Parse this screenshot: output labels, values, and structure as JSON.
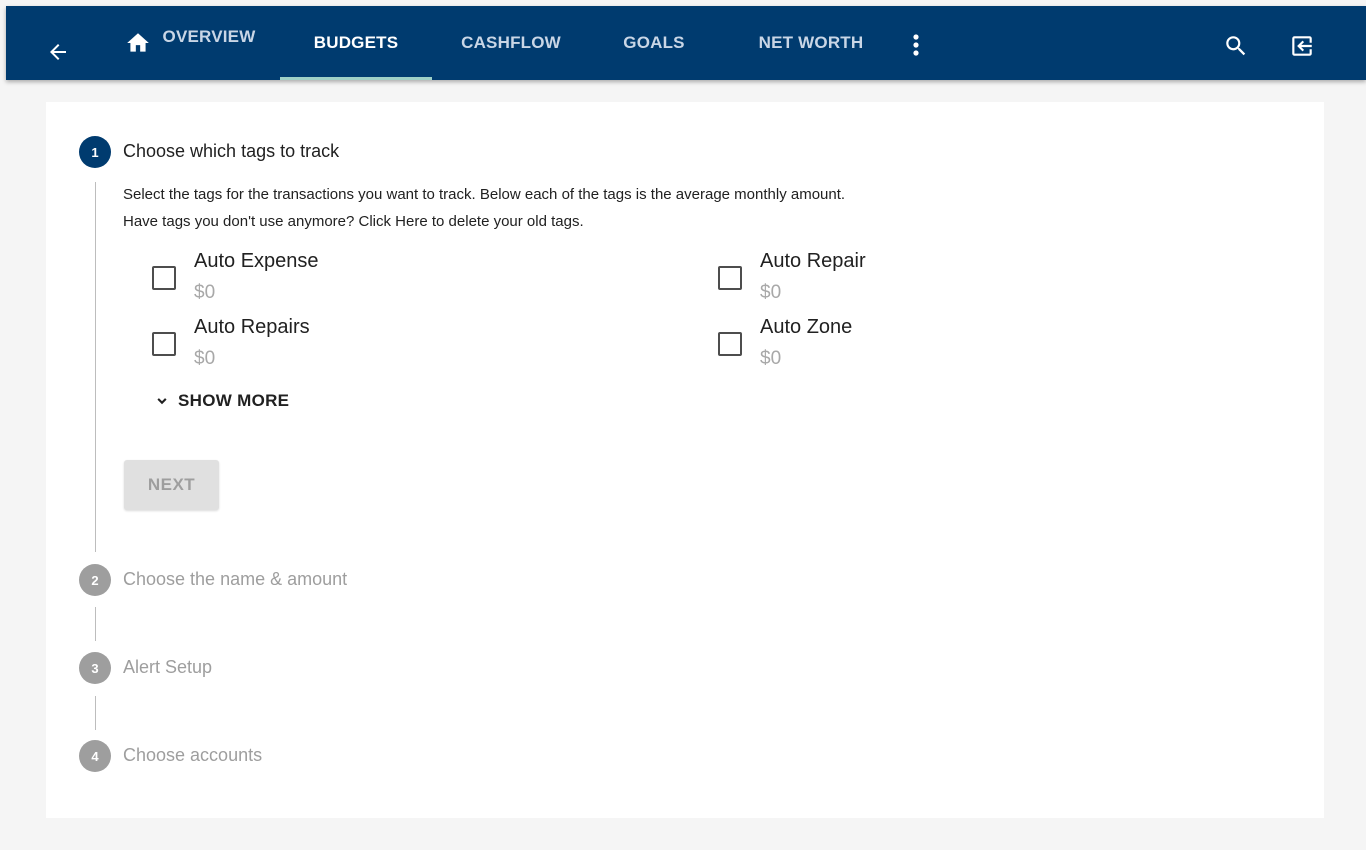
{
  "nav": {
    "tabs": [
      {
        "label": "OVERVIEW"
      },
      {
        "label": "BUDGETS"
      },
      {
        "label": "CASHFLOW"
      },
      {
        "label": "GOALS"
      },
      {
        "label": "NET WORTH"
      }
    ],
    "active_tab": "BUDGETS"
  },
  "colors": {
    "topbar": "#003b6f",
    "active_underline": "#9ed1c7",
    "active_step": "#003b6f",
    "inactive_step": "#9e9e9e"
  },
  "stepper": {
    "steps": [
      {
        "number": "1",
        "title": "Choose which tags to track"
      },
      {
        "number": "2",
        "title": "Choose the name & amount"
      },
      {
        "number": "3",
        "title": "Alert Setup"
      },
      {
        "number": "4",
        "title": "Choose accounts"
      }
    ],
    "description_line1": "Select the tags for the transactions you want to track. Below each of the tags is the average monthly amount.",
    "description_line2_prefix": "Have tags you don't use anymore? ",
    "description_line2_link": "Click Here",
    "description_line2_suffix": " to delete your old tags.",
    "tags": [
      {
        "name": "Auto Expense",
        "amount": "$0",
        "checked": false
      },
      {
        "name": "Auto Repair",
        "amount": "$0",
        "checked": false
      },
      {
        "name": "Auto Repairs",
        "amount": "$0",
        "checked": false
      },
      {
        "name": "Auto Zone",
        "amount": "$0",
        "checked": false
      }
    ],
    "show_more_label": "SHOW MORE",
    "next_label": "NEXT"
  }
}
